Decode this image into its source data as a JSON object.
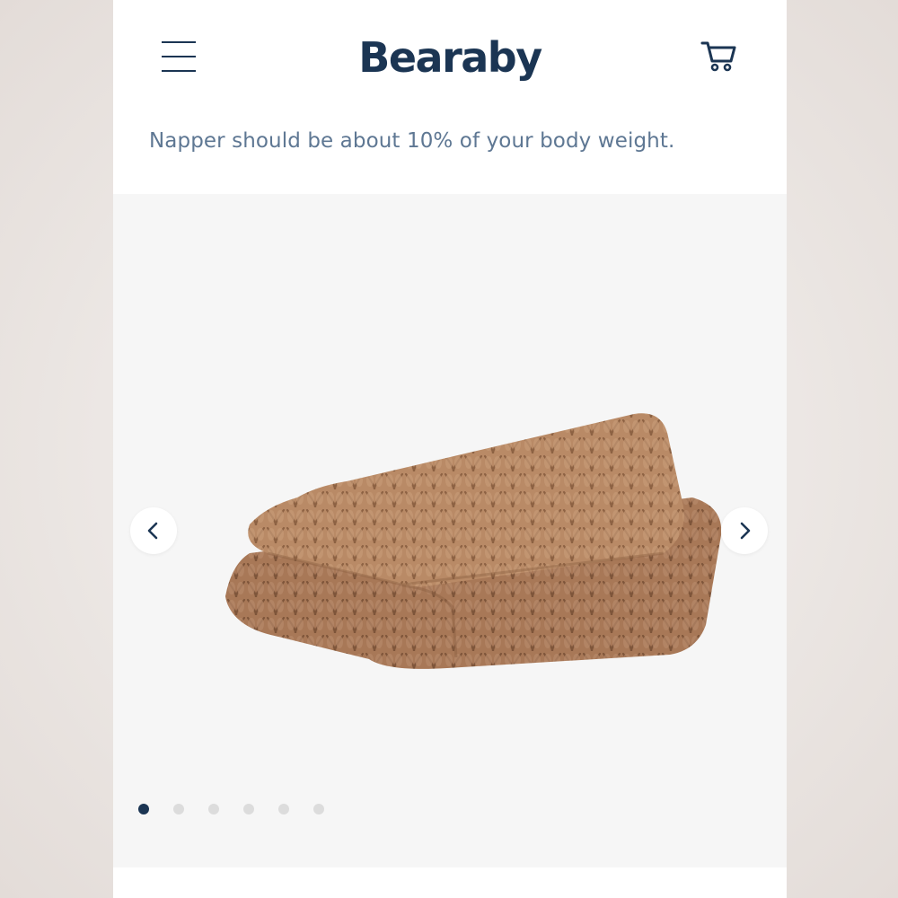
{
  "header": {
    "logo_text": "Bearaby",
    "menu_icon": "hamburger-menu-icon",
    "cart_icon": "shopping-cart-icon"
  },
  "tip": {
    "text": "Napper should be about 10% of your body weight."
  },
  "gallery": {
    "image": "knit-weighted-blanket-photo",
    "prev_icon": "chevron-left-icon",
    "next_icon": "chevron-right-icon",
    "slide_count": 6,
    "active_slide": 1
  },
  "colors": {
    "brand_navy": "#1b3553",
    "tip_text": "#5e7793",
    "blanket": "#b98a66",
    "dot_inactive": "#dcdcdc"
  }
}
